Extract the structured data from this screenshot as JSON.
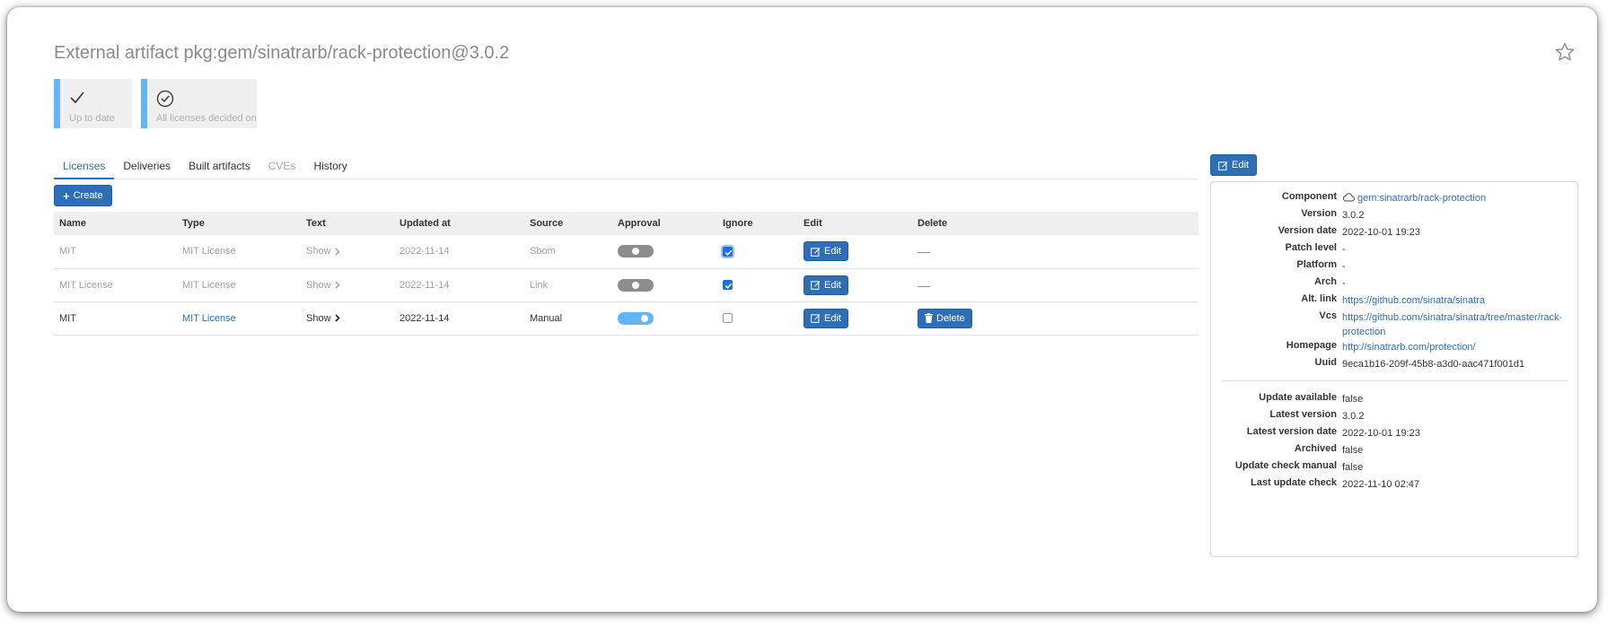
{
  "page": {
    "title": "External artifact pkg:gem/sinatrarb/rack-protection@3.0.2"
  },
  "status_cards": [
    {
      "label": "Up to date",
      "icon": "check-icon"
    },
    {
      "label": "All licenses decided on",
      "icon": "check-circle-icon"
    }
  ],
  "tabs": [
    {
      "label": "Licenses",
      "state": "active"
    },
    {
      "label": "Deliveries",
      "state": "normal"
    },
    {
      "label": "Built artifacts",
      "state": "normal"
    },
    {
      "label": "CVEs",
      "state": "disabled"
    },
    {
      "label": "History",
      "state": "normal"
    }
  ],
  "toolbar": {
    "create_label": "Create",
    "edit_label": "Edit"
  },
  "licenses_table": {
    "columns": [
      "Name",
      "Type",
      "Text",
      "Updated at",
      "Source",
      "Approval",
      "Ignore",
      "Edit",
      "Delete"
    ],
    "rows": [
      {
        "name": "MIT",
        "type": "MIT License",
        "text": "Show",
        "updated_at": "2022-11-14",
        "source": "Sbom",
        "approval": false,
        "ignore": true,
        "edit_label": "Edit",
        "delete": "—",
        "dimmed": true
      },
      {
        "name": "MIT License",
        "type": "MIT License",
        "text": "Show",
        "updated_at": "2022-11-14",
        "source": "Link",
        "approval": false,
        "ignore": true,
        "edit_label": "Edit",
        "delete": "—",
        "dimmed": true
      },
      {
        "name": "MIT",
        "type": "MIT License",
        "text": "Show",
        "updated_at": "2022-11-14",
        "source": "Manual",
        "approval": true,
        "ignore": false,
        "edit_label": "Edit",
        "delete": "Delete",
        "dimmed": false
      }
    ]
  },
  "details": {
    "component": {
      "label": "Component",
      "value": "gem:sinatrarb/rack-protection"
    },
    "version": {
      "label": "Version",
      "value": "3.0.2"
    },
    "version_date": {
      "label": "Version date",
      "value": "2022-10-01 19:23"
    },
    "patch_level": {
      "label": "Patch level",
      "value": "-"
    },
    "platform": {
      "label": "Platform",
      "value": "-"
    },
    "arch": {
      "label": "Arch",
      "value": "-"
    },
    "alt_link": {
      "label": "Alt. link",
      "value": "https://github.com/sinatra/sinatra"
    },
    "vcs": {
      "label": "Vcs",
      "value": "https://github.com/sinatra/sinatra/tree/master/rack-protection"
    },
    "homepage": {
      "label": "Homepage",
      "value": "http://sinatrarb.com/protection/"
    },
    "uuid": {
      "label": "Uuid",
      "value": "9eca1b16-209f-45b8-a3d0-aac471f001d1"
    },
    "update_available": {
      "label": "Update available",
      "value": "false"
    },
    "latest_version": {
      "label": "Latest version",
      "value": "3.0.2"
    },
    "latest_version_date": {
      "label": "Latest version date",
      "value": "2022-10-01 19:23"
    },
    "archived": {
      "label": "Archived",
      "value": "false"
    },
    "update_check_manual": {
      "label": "Update check manual",
      "value": "false"
    },
    "last_update_check": {
      "label": "Last update check",
      "value": "2022-11-10 02:47"
    }
  },
  "colors": {
    "accent": "#2d6eb7",
    "status_bar": "#64b5f6",
    "checkbox": "#1e6fe0"
  }
}
